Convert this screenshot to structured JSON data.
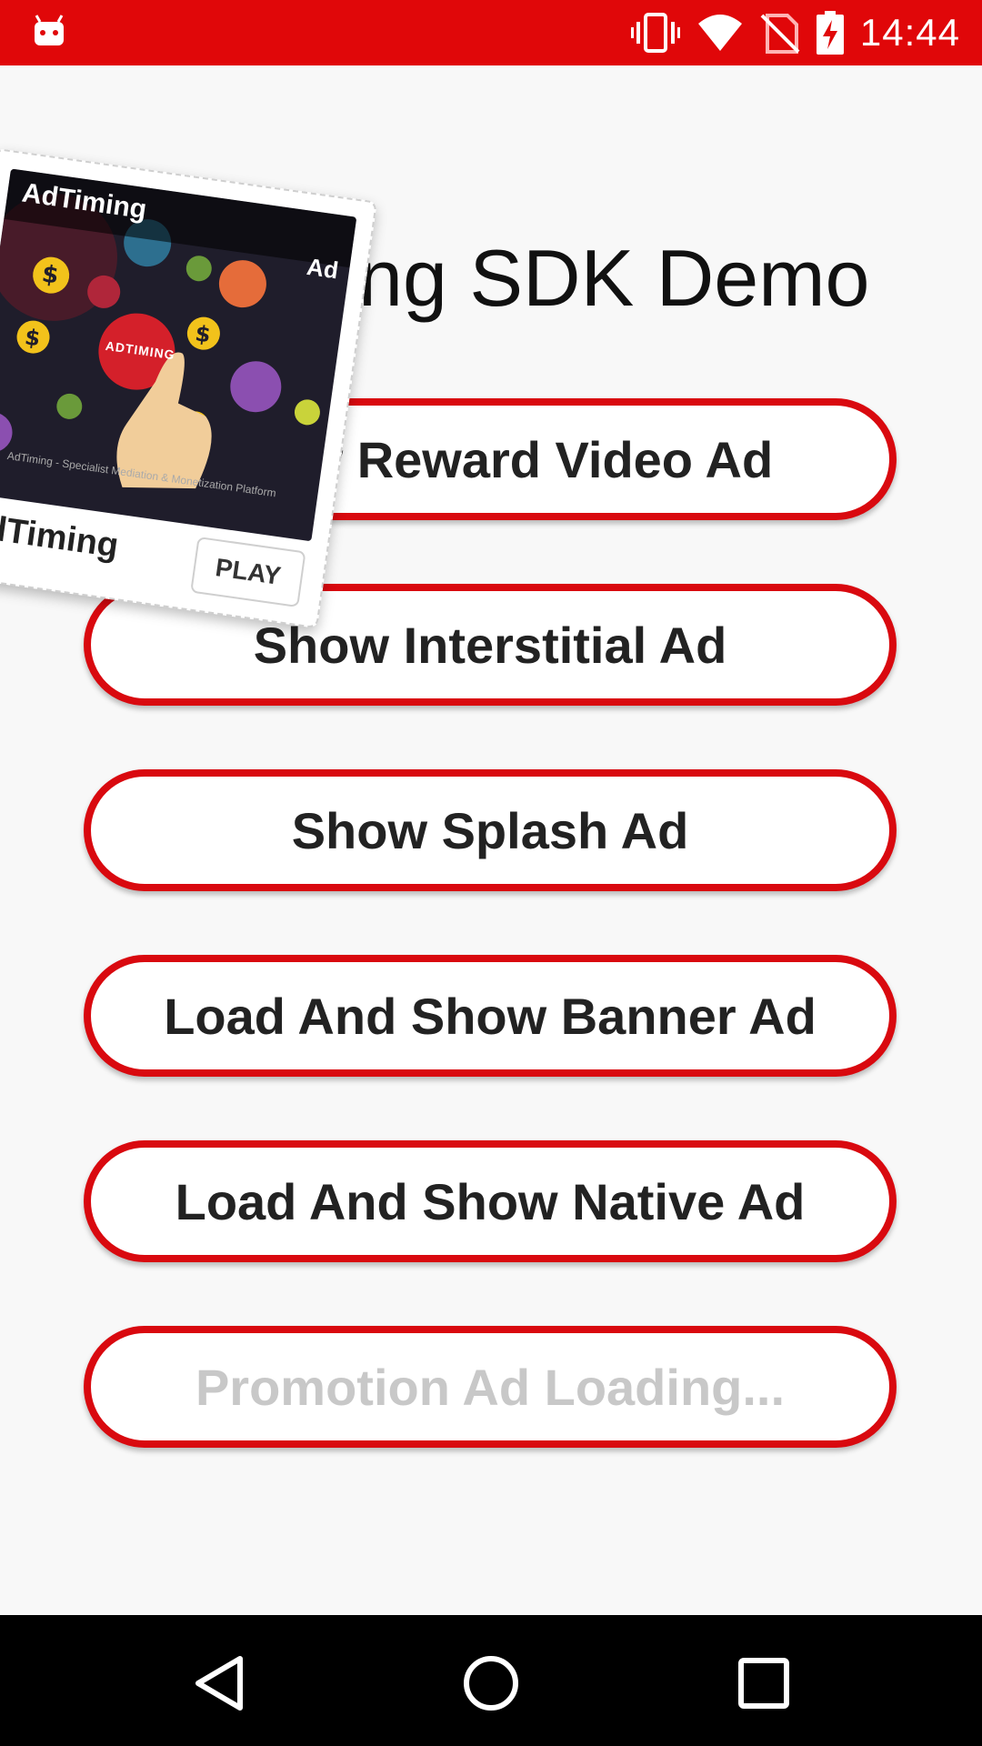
{
  "status_bar": {
    "time": "14:44",
    "icons": [
      "android-icon",
      "vibrate-icon",
      "wifi-icon",
      "no-sim-icon",
      "battery-charging-icon"
    ],
    "color": "#e00709"
  },
  "title": "AdTiming SDK Demo",
  "buttons": [
    {
      "label": "Show Reward Video Ad"
    },
    {
      "label": "Show Interstitial Ad"
    },
    {
      "label": "Show Splash Ad"
    },
    {
      "label": "Load And Show Banner Ad"
    },
    {
      "label": "Load And Show Native Ad"
    },
    {
      "label": "Promotion Ad Loading..."
    }
  ],
  "ad_card": {
    "brand_top": "AdTiming",
    "badge": "Ad",
    "logo_text": "ADTIMING",
    "caption": "AdTiming - Specialist Mediation & Monetization Platform",
    "brand_bottom": "AdTiming",
    "play_label": "PLAY"
  },
  "nav_bar": {
    "icons": [
      "back-icon",
      "home-icon",
      "recents-icon"
    ]
  },
  "colors": {
    "accent": "#d9090f",
    "background": "#f8f8f8",
    "button_text": "#222222",
    "disabled_text": "#c8c8c8"
  }
}
